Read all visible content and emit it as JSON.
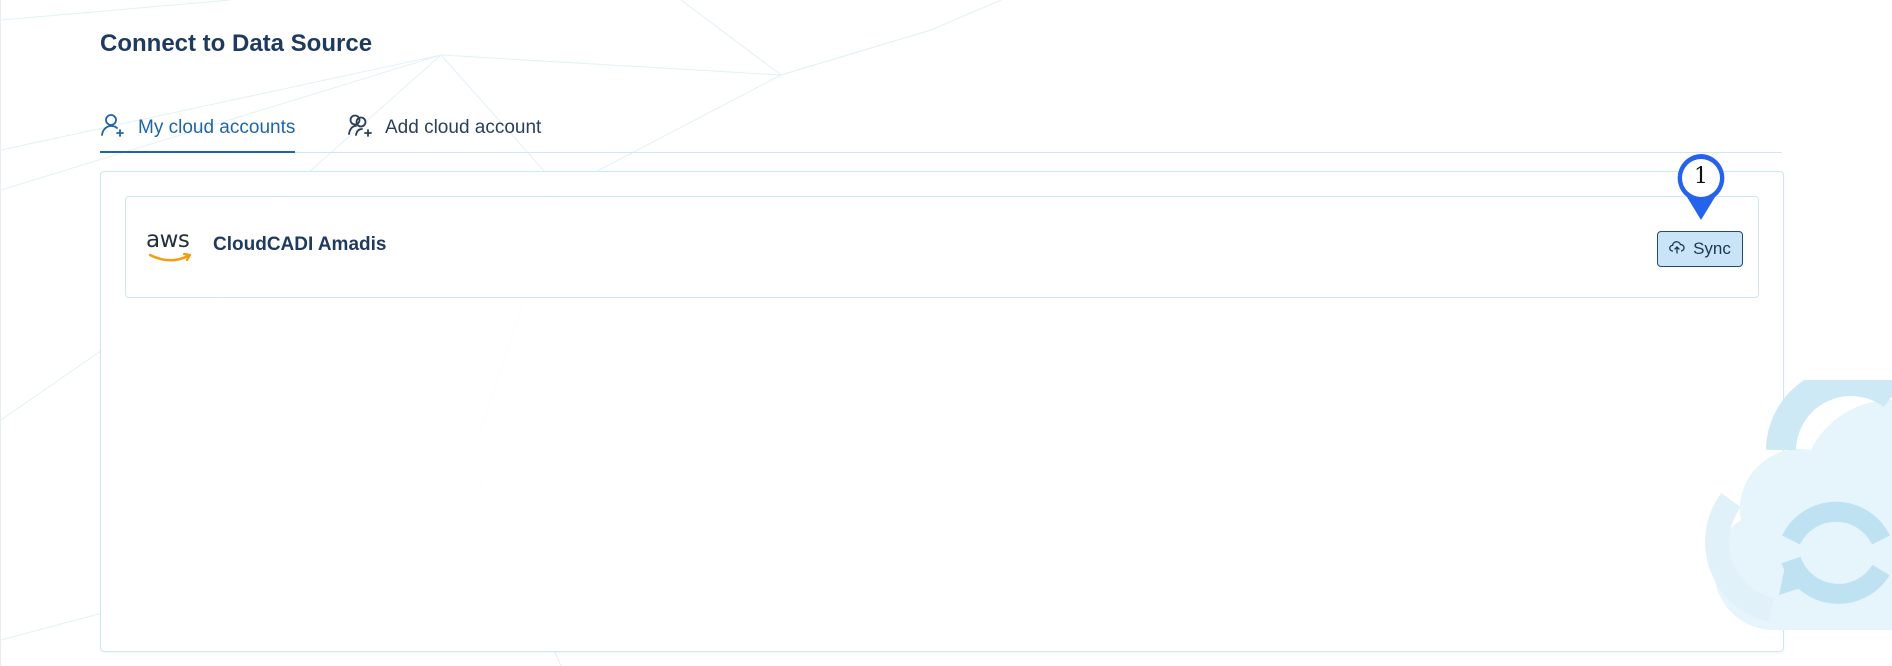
{
  "page": {
    "title": "Connect to Data Source"
  },
  "tabs": [
    {
      "label": "My cloud accounts",
      "active": true,
      "icon": "user-plus-icon"
    },
    {
      "label": "Add cloud account",
      "active": false,
      "icon": "users-plus-icon"
    }
  ],
  "accounts": [
    {
      "provider": "aws",
      "provider_logo_text": "aws",
      "name": "CloudCADI Amadis",
      "action_label": "Sync",
      "action_icon": "cloud-sync-icon"
    }
  ],
  "marker": {
    "number": "1"
  },
  "colors": {
    "accent": "#1e66a8",
    "title": "#1f3a5f",
    "sync_bg": "#c9e4f7",
    "marker": "#2563eb",
    "aws_orange": "#f39c12"
  }
}
